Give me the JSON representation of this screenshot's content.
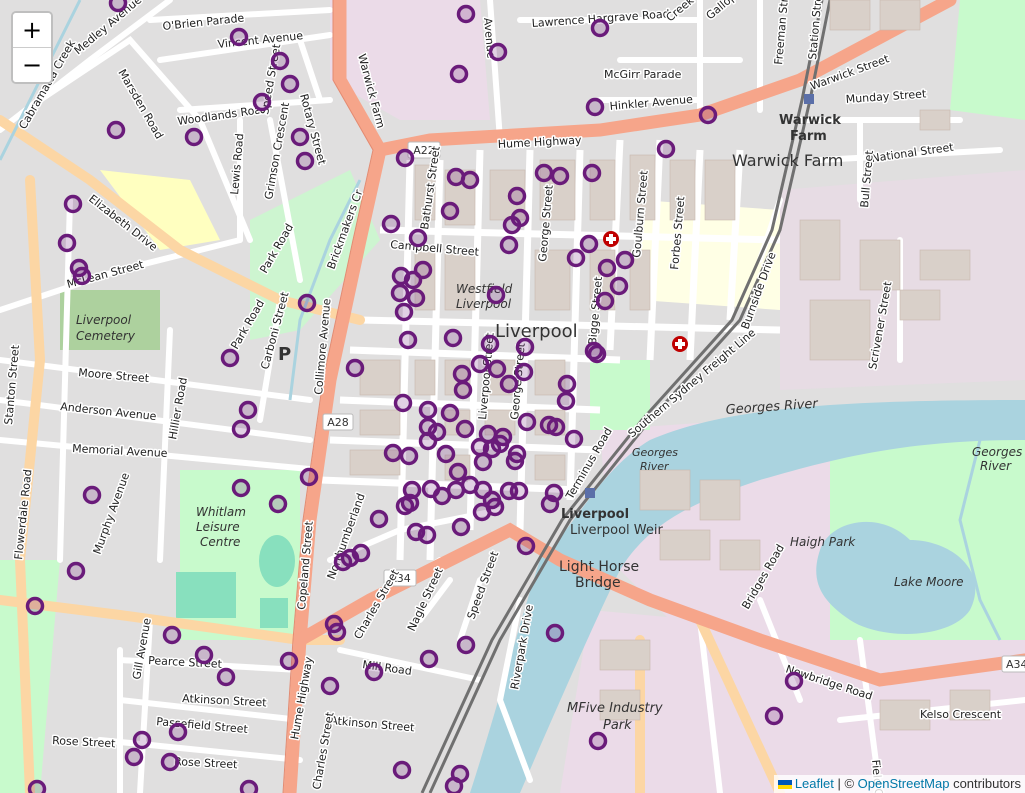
{
  "map": {
    "center_label": "Liverpool",
    "places": {
      "warwick_farm": "Warwick Farm",
      "warwick_station_1": "Warwick",
      "warwick_station_2": "Farm",
      "liverpool_station": "Liverpool",
      "liverpool_weir": "Liverpool Weir",
      "light_horse_1": "Light Horse",
      "light_horse_2": "Bridge",
      "westfield_1": "Westfield",
      "westfield_2": "Liverpool",
      "cemetery_1": "Liverpool",
      "cemetery_2": "Cemetery",
      "whitlam_1": "Whitlam",
      "whitlam_2": "Leisure",
      "whitlam_3": "Centre",
      "haigh_park": "Haigh Park",
      "lake_moore": "Lake Moore",
      "mfive_1": "MFive Industry",
      "mfive_2": "Park",
      "georges_river": "Georges River",
      "georges_river_b1": "Georges",
      "georges_river_b2": "River",
      "georges_river_c1": "Georges",
      "georges_river_c2": "River",
      "parking": "P"
    },
    "roads": {
      "a22": "A22",
      "a28": "A28",
      "a34": "A34",
      "a34b": "A34",
      "hume_highway": "Hume Highway",
      "hume_highway_v": "Hume Highway",
      "elizabeth_drive": "Elizabeth Drive",
      "newbridge_road": "Newbridge Road",
      "copeland_street": "Copeland Street",
      "flowerdale_road": "Flowerdale Road",
      "memorial_avenue": "Memorial Avenue",
      "moore_street": "Moore Street",
      "anderson_avenue": "Anderson Avenue",
      "mclean_street": "McLean Street",
      "campbell_street": "Campbell Street",
      "obrien_parade": "O'Brien Parade",
      "vincent_avenue": "Vincent Avenue",
      "medley_avenue": "Medley Avenue",
      "marsden_road": "Marsden Road",
      "woodlands_road": "Woodlands Road",
      "lewis_road": "Lewis Road",
      "grimson_crescent": "Grimson Crescent",
      "park_road": "Park Road",
      "rotary_street": "Rotary Street",
      "speed_street": "Speed Street",
      "lawrence_hargrave": "Lawrence Hargrave Road",
      "mcgirr_parade": "McGirr Parade",
      "hinkler_avenue": "Hinkler Avenue",
      "munday_street": "Munday Street",
      "national_street": "National Street",
      "warwick_street": "Warwick Street",
      "bull_street": "Bull Street",
      "scrivener_street": "Scrivener Street",
      "burnside_drive": "Burnside Drive",
      "forbes_street": "Forbes Street",
      "goulburn_street": "Goulburn Street",
      "bigge_street": "Bigge Street",
      "george_street": "George Street",
      "george_street_2": "George Street",
      "bathurst_street": "Bathurst Street",
      "collimore_avenue": "Collimore Avenue",
      "carboni_street": "Carboni Street",
      "park_road_2": "Park Road",
      "hillier_road": "Hillier Road",
      "murphy_avenue": "Murphy Avenue",
      "stanton_street": "Stanton Street",
      "gill_avenue": "Gill Avenue",
      "pearce_street": "Pearce Street",
      "atkinson_street": "Atkinson Street",
      "atkinson_street_2": "Atkinson Street",
      "passefield_street": "Passefield Street",
      "rose_street": "Rose Street",
      "rose_street_2": "Rose Street",
      "mill_road": "Mill Road",
      "charles_street": "Charles Street",
      "charles_street_2": "Charles Street",
      "nagle_street": "Nagle Street",
      "speed_street_2": "Speed Street",
      "riverpark_drive": "Riverpark Drive",
      "bridges_road": "Bridges Road",
      "field_close": "Field Close",
      "kelso_crescent": "Kelso Crescent",
      "station_street": "Station Street",
      "freeman_street": "Freeman Street",
      "gallop_street": "Gallop Street",
      "southern_sydney_freight_line": "Southern Sydney Freight Line",
      "terminus_road": "Terminus Road",
      "brickmakers_creek": "Brickmakers Cr",
      "cabramatta_creek": "Cabramatta Creek",
      "warwick_farm_v": "Warwick Farm",
      "creek_top": "Creek",
      "nth_street": "Newbridge Road",
      "avenue_top": "Avenue",
      "liverpool_street": "Liverpool Street",
      "northumberland": "Northumberland",
      "moore_lane": "Moore"
    },
    "markers": {
      "stroke_color": "#6a1b7a",
      "count": 150
    }
  },
  "controls": {
    "zoom_in": "+",
    "zoom_out": "−"
  },
  "attribution": {
    "leaflet": "Leaflet",
    "separator": " | © ",
    "osm": "OpenStreetMap",
    "suffix": " contributors"
  },
  "colors": {
    "background": "#f2efe9",
    "trunk_road": "#f6a58a",
    "primary_road": "#fcd6a4",
    "water": "#aad3df",
    "park": "#c8facc",
    "industrial": "#ebdbe8",
    "marker": "#6a1b7a"
  }
}
